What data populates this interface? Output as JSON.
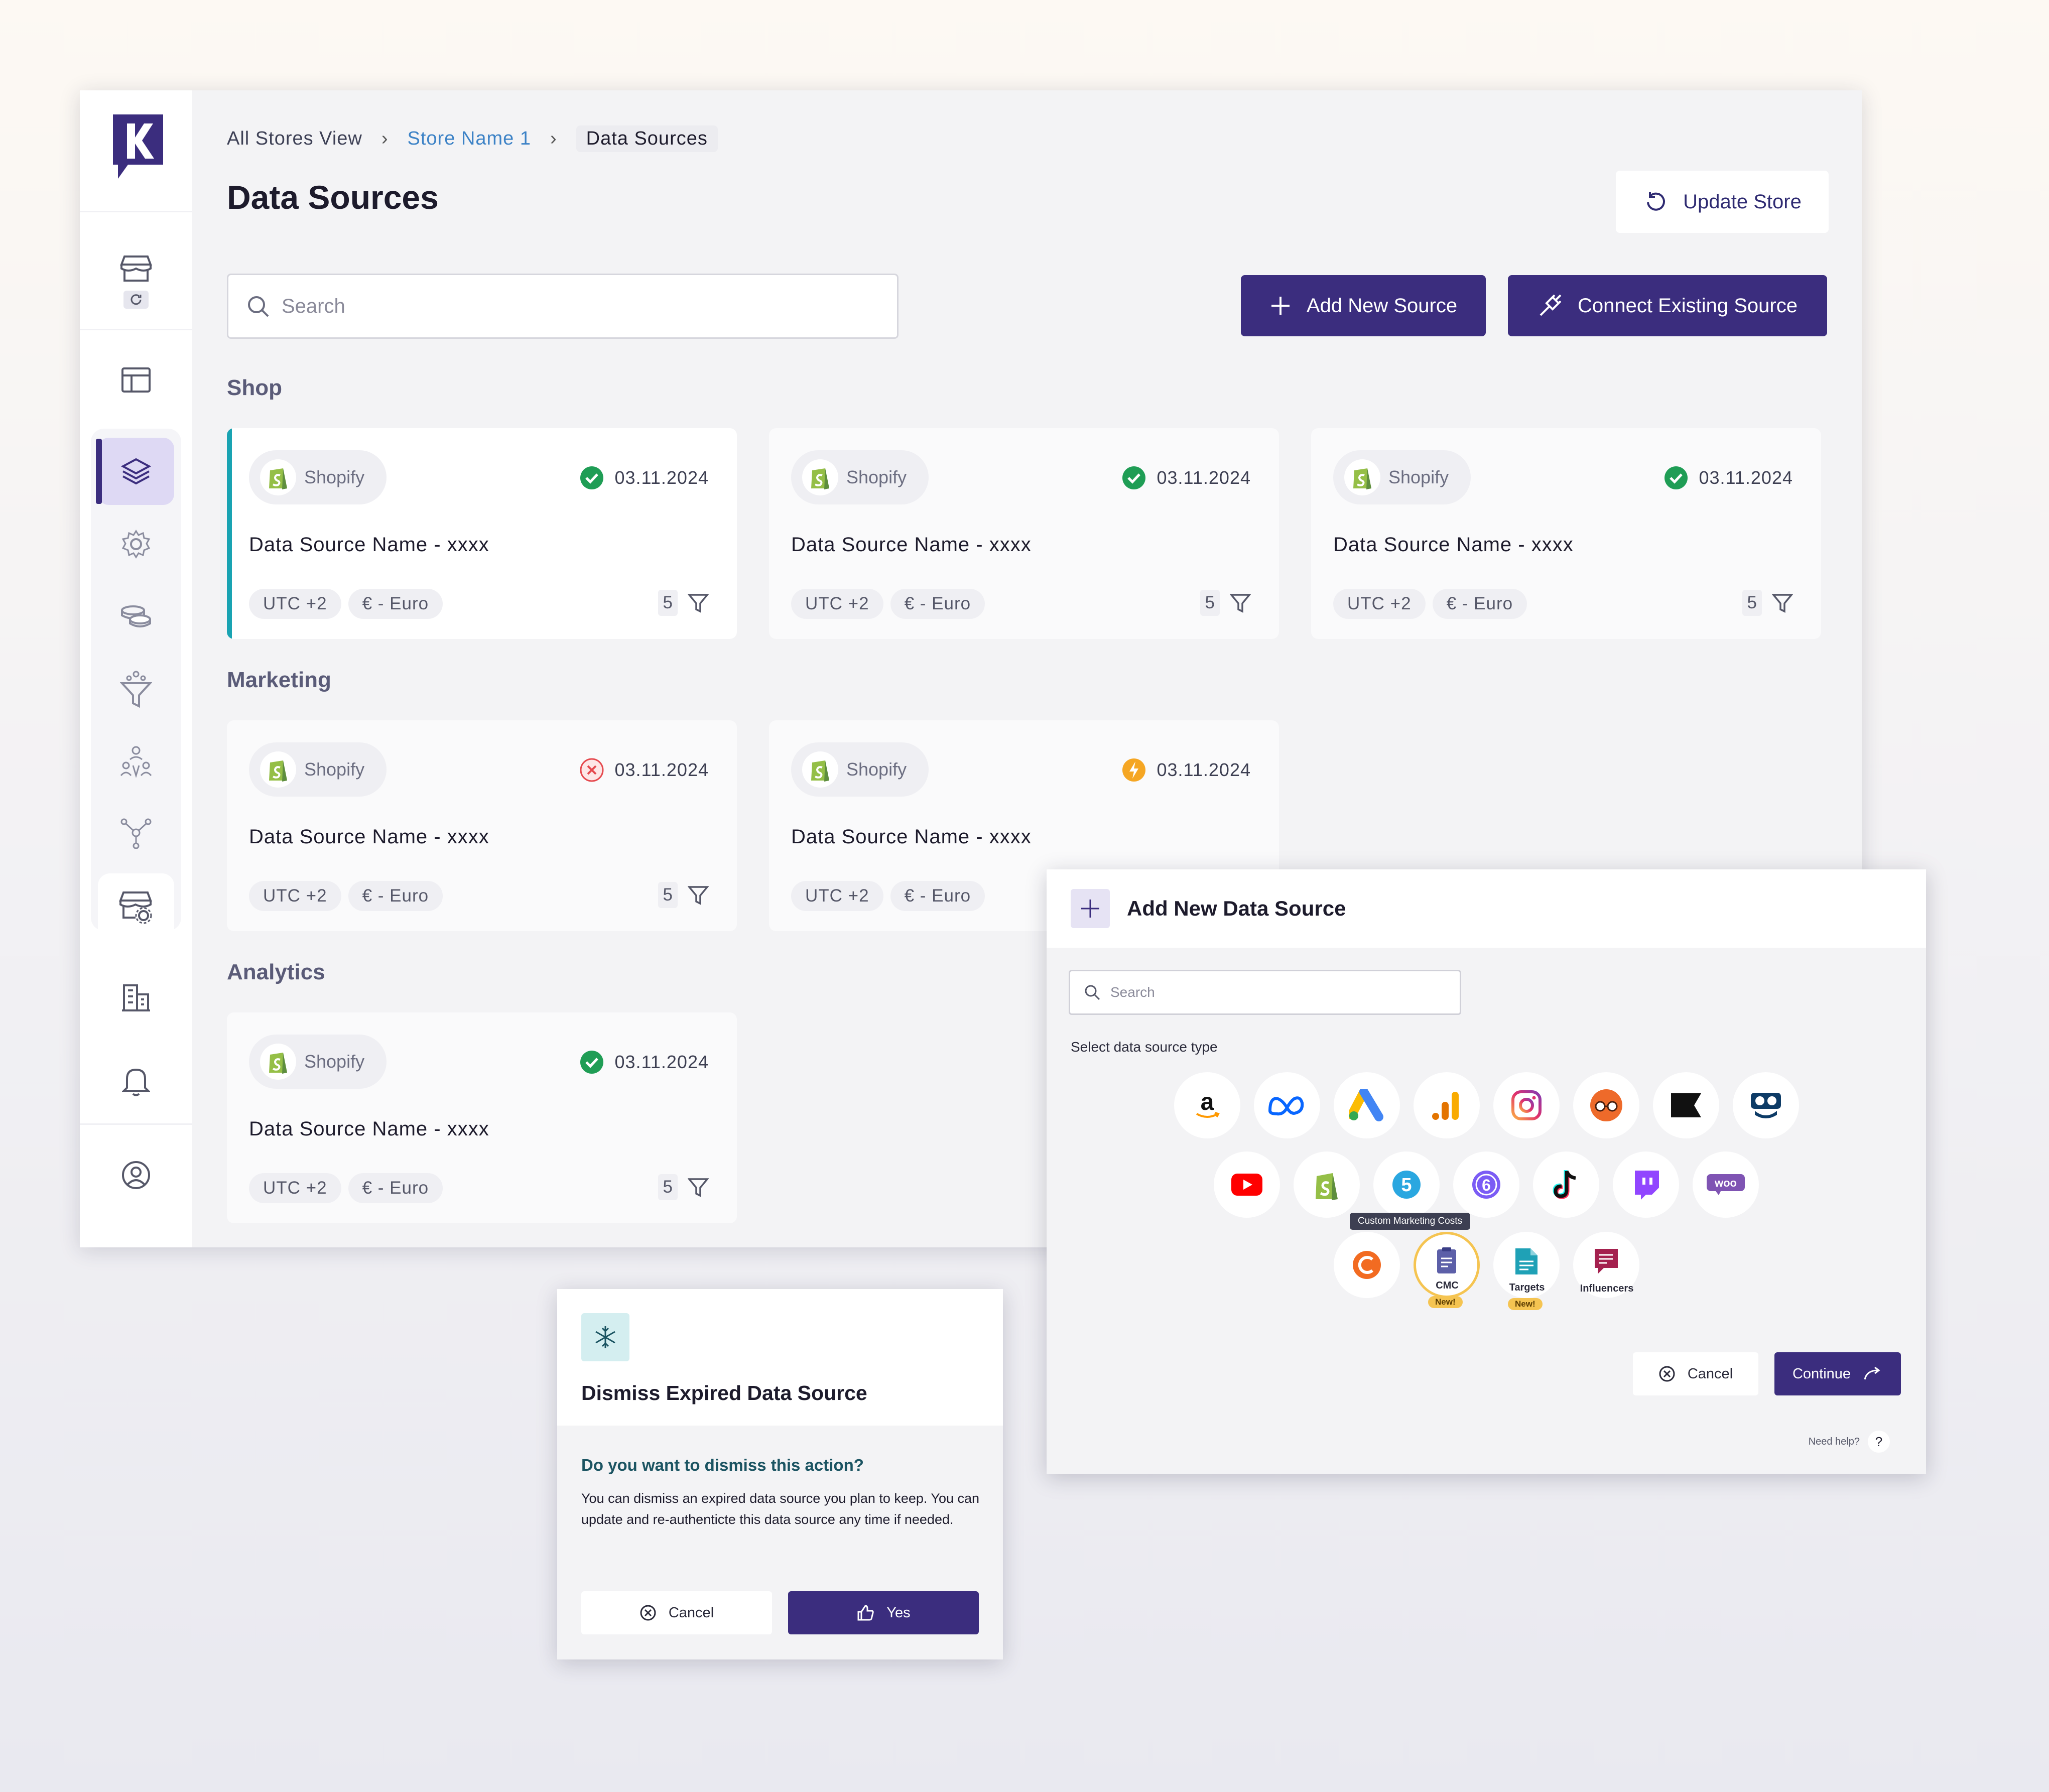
{
  "breadcrumb": {
    "item1": "All Stores View",
    "item2": "Store Name 1",
    "item3": "Data Sources"
  },
  "page": {
    "title": "Data Sources",
    "update_label": "Update Store",
    "search_placeholder": "Search",
    "add_label": "Add New Source",
    "connect_label": "Connect Existing Source"
  },
  "sections": {
    "shop": "Shop",
    "marketing": "Marketing",
    "analytics": "Analytics"
  },
  "cards": [
    {
      "source": "Shopify",
      "status": "ok",
      "date": "03.11.2024",
      "name": "Data Source Name - xxxx",
      "tz": "UTC +2",
      "currency": "€ - Euro",
      "count": "5"
    },
    {
      "source": "Shopify",
      "status": "ok",
      "date": "03.11.2024",
      "name": "Data Source Name - xxxx",
      "tz": "UTC +2",
      "currency": "€ - Euro",
      "count": "5"
    },
    {
      "source": "Shopify",
      "status": "ok",
      "date": "03.11.2024",
      "name": "Data Source Name - xxxx",
      "tz": "UTC +2",
      "currency": "€ - Euro",
      "count": "5"
    },
    {
      "source": "Shopify",
      "status": "error",
      "date": "03.11.2024",
      "name": "Data Source Name - xxxx",
      "tz": "UTC +2",
      "currency": "€ - Euro",
      "count": "5"
    },
    {
      "source": "Shopify",
      "status": "warning",
      "date": "03.11.2024",
      "name": "Data Source Name - xxxx",
      "tz": "UTC +2",
      "currency": "€ - Euro",
      "count": "5"
    },
    {
      "source": "Shopify",
      "status": "ok",
      "date": "03.11.2024",
      "name": "Data Source Name - xxxx",
      "tz": "UTC +2",
      "currency": "€ - Euro",
      "count": "5"
    }
  ],
  "add_modal": {
    "title": "Add New Data Source",
    "search_placeholder": "Search",
    "select_label": "Select data source type",
    "tooltip": "Custom Marketing Costs",
    "cmc_label": "CMC",
    "targets_label": "Targets",
    "influencers_label": "Influencers",
    "new_badge": "New!",
    "cancel_label": "Cancel",
    "continue_label": "Continue",
    "help_label": "Need help?",
    "help_q": "?",
    "sources": [
      "amazon-icon",
      "meta-icon",
      "google-ads-icon",
      "google-analytics-icon",
      "instagram-icon",
      "glasses-icon",
      "klaviyo-icon",
      "criteo-icon",
      "youtube-icon",
      "shopify-icon",
      "five-icon",
      "six-icon",
      "tiktok-icon",
      "twitch-icon",
      "woo-icon",
      "c-icon",
      "cmc-icon",
      "targets-icon",
      "influencers-icon"
    ]
  },
  "dismiss_modal": {
    "title": "Dismiss Expired Data Source",
    "question": "Do you want to dismiss this action?",
    "body": "You can dismiss an expired data source you plan to keep. You can update and re-authenticte this data source any time if needed.",
    "cancel_label": "Cancel",
    "yes_label": "Yes"
  },
  "colors": {
    "primary": "#3b2d7e",
    "accent": "#19a3b2",
    "ok": "#1f9d55",
    "error": "#e5484d",
    "warning": "#f5a623"
  }
}
